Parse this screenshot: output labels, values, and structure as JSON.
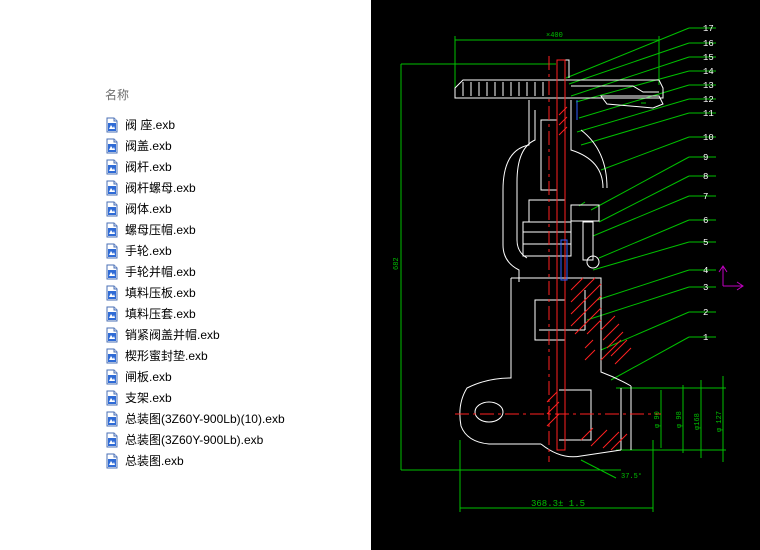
{
  "explorer": {
    "column_header": "名称",
    "files": [
      {
        "name": "阀 座.exb"
      },
      {
        "name": "阀盖.exb"
      },
      {
        "name": "阀杆.exb"
      },
      {
        "name": "阀杆螺母.exb"
      },
      {
        "name": "阀体.exb"
      },
      {
        "name": "螺母压帽.exb"
      },
      {
        "name": "手轮.exb"
      },
      {
        "name": "手轮并帽.exb"
      },
      {
        "name": "填料压板.exb"
      },
      {
        "name": "填料压套.exb"
      },
      {
        "name": "销紧阀盖并帽.exb"
      },
      {
        "name": "楔形蜜封垫.exb"
      },
      {
        "name": "闸板.exb"
      },
      {
        "name": "支架.exb"
      },
      {
        "name": "总装图(3Z60Y-900Lb)(10).exb"
      },
      {
        "name": "总装图(3Z60Y-900Lb).exb"
      },
      {
        "name": "总装图.exb"
      }
    ],
    "file_icon": "document-icon"
  },
  "preview": {
    "background": "#000000",
    "part_numbers": [
      "17",
      "16",
      "15",
      "14",
      "13",
      "12",
      "11",
      "10",
      "9",
      "8",
      "7",
      "6",
      "5",
      "4",
      "3",
      "2",
      "1"
    ],
    "dim_top": "×400",
    "dim_height": "682",
    "dim_bottom": "368.3± 1.5",
    "dim_angle": "37.5°",
    "dim_d1": "φ 90",
    "dim_d2": "φ 98",
    "dim_d3": "φ168",
    "dim_d4": "φ 127",
    "line_colors": {
      "outline": "#ffffff",
      "dimension": "#00c000",
      "center": "#ff2020",
      "hatch": "#ff2020",
      "axis": "#c000c0"
    }
  }
}
